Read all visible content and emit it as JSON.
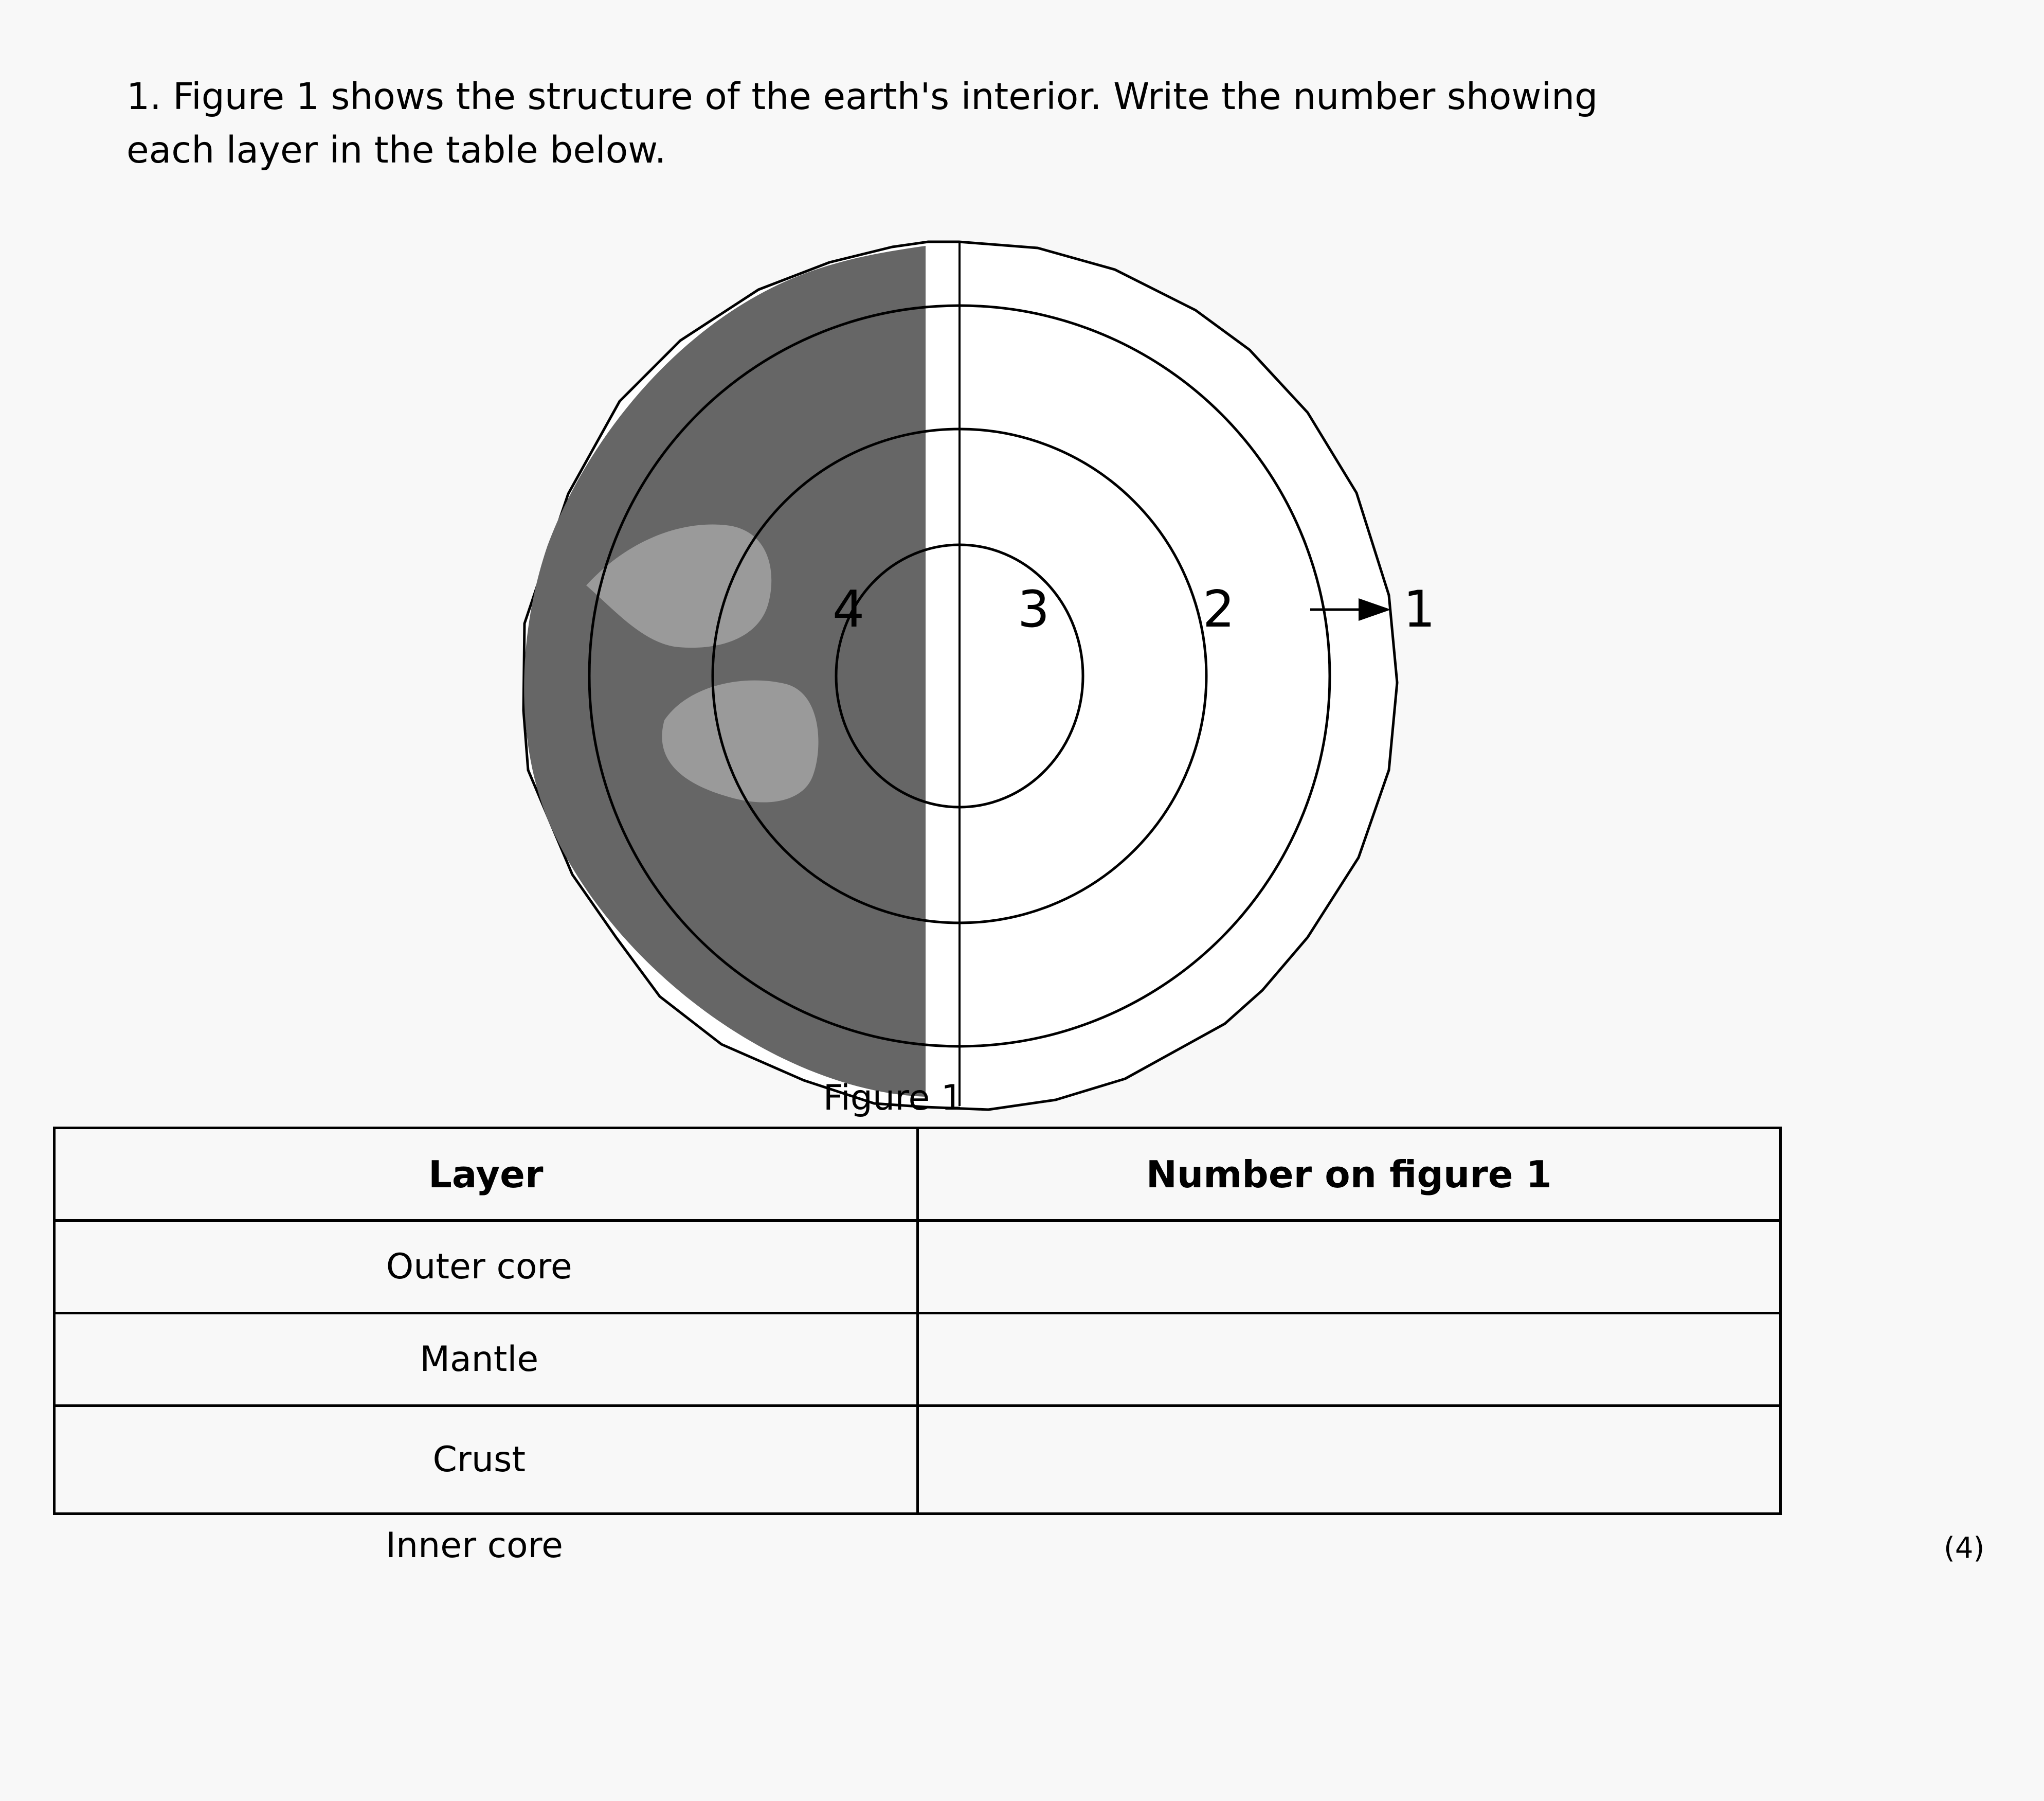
{
  "question": {
    "line1": "1. Figure 1 shows the structure of the earth's interior. Write the number showing",
    "line2": "each layer in the table below."
  },
  "figure": {
    "labels": [
      "4",
      "3",
      "2",
      "1"
    ],
    "caption": "Figure 1"
  },
  "table": {
    "headers": [
      "Layer",
      "Number on figure 1"
    ],
    "rows": [
      {
        "layer": "Outer core",
        "number": ""
      },
      {
        "layer": "Mantle",
        "number": ""
      },
      {
        "layer": "Crust",
        "number": ""
      }
    ]
  },
  "extra_option": "Inner core",
  "marks": "(4)"
}
